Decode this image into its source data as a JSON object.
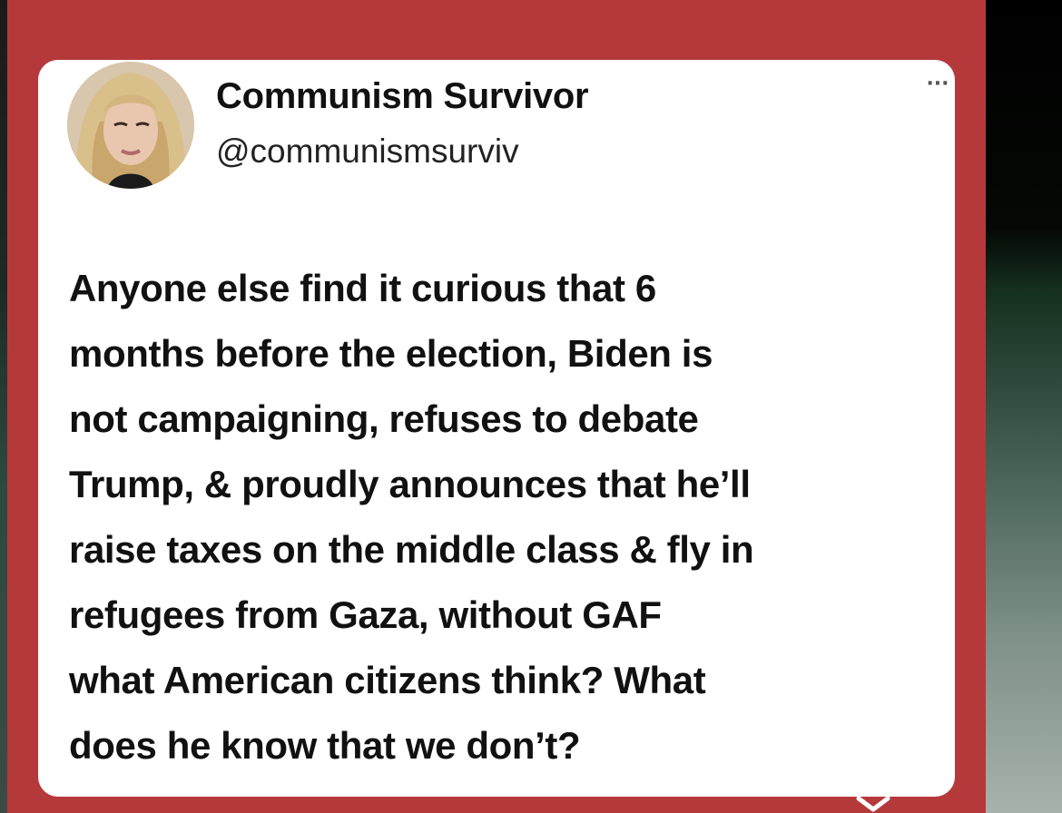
{
  "tweet": {
    "display_name": "Communism Survivor",
    "handle": "@communismsurviv",
    "more_icon": "more-horizontal-icon",
    "text_lines": [
      "Anyone else find it curious that 6",
      "months before the election, Biden is",
      "not campaigning, refuses to debate",
      "Trump, & proudly announces that he’ll",
      "raise taxes on the middle class & fly in",
      "refugees from Gaza, without GAF",
      "what American citizens think? What",
      "does he know that we don’t?"
    ]
  },
  "colors": {
    "panel_background": "#b5393b",
    "card_background": "#ffffff",
    "text": "#111111"
  },
  "icons": {
    "avatar": "profile-photo",
    "bottom": "chevron-down-icon"
  }
}
